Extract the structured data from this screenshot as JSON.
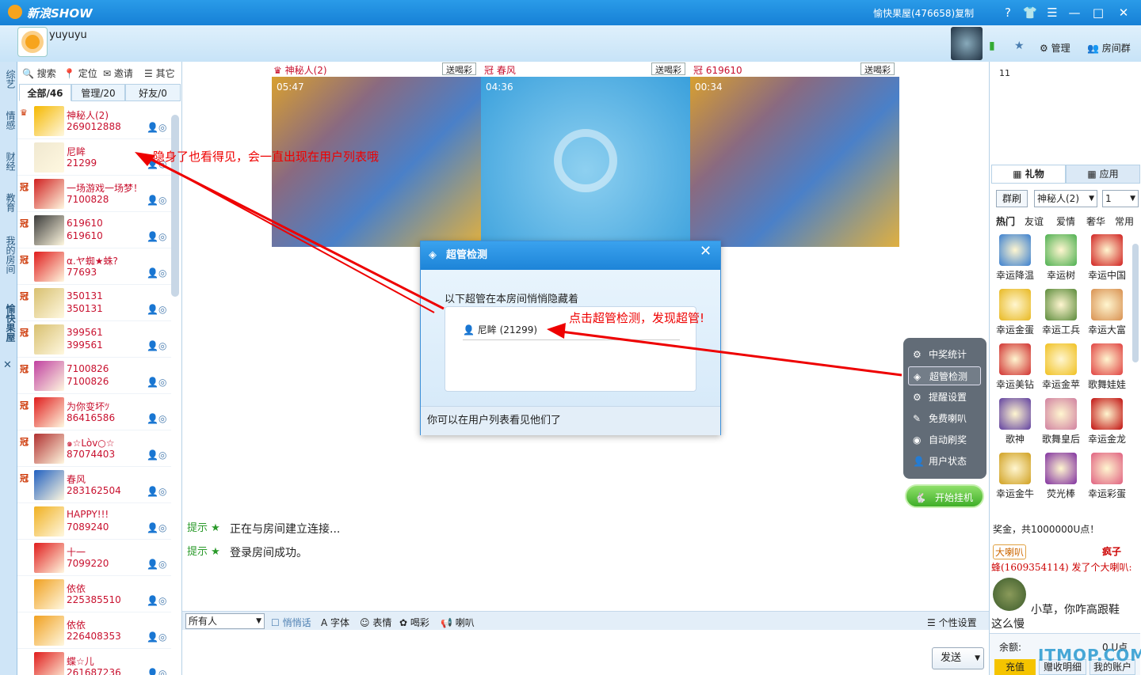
{
  "app": {
    "logo": "新浪SHOW",
    "room_title": "愉快果屋(476658)复制",
    "user": "yuyuyu"
  },
  "topbar": {
    "manage": "管理",
    "room_group": "房间群"
  },
  "left_tabs": [
    "综艺",
    "情感",
    "财经",
    "教育",
    "我的房间",
    "愉快果屋"
  ],
  "userpanel": {
    "tools": [
      "搜索",
      "定位",
      "邀请",
      "其它"
    ],
    "tabs": [
      "全部/46",
      "管理/20",
      "好友/0"
    ],
    "users": [
      {
        "name": "神秘人(2)",
        "id": "269012888",
        "badge": "♛",
        "color": "#f5b800"
      },
      {
        "name": "尼眸",
        "id": "21299",
        "badge": "",
        "color": "#f0e8d0"
      },
      {
        "name": "一场游戏一场梦！",
        "id": "7100828",
        "badge": "冠",
        "color": "#d02020"
      },
      {
        "name": "619610",
        "id": "619610",
        "badge": "冠",
        "color": "#3a3a3a"
      },
      {
        "name": "α.ヤ蜘★蛛?",
        "id": "77693",
        "badge": "冠",
        "color": "#e01c1c"
      },
      {
        "name": "350131",
        "id": "350131",
        "badge": "冠",
        "color": "#d8c070"
      },
      {
        "name": "399561",
        "id": "399561",
        "badge": "冠",
        "color": "#d8c070"
      },
      {
        "name": "7100826",
        "id": "7100826",
        "badge": "冠",
        "color": "#c040a0"
      },
      {
        "name": "为你变坏ﾂ",
        "id": "86416586",
        "badge": "冠",
        "color": "#e01c1c"
      },
      {
        "name": "๑☆Lòv○☆",
        "id": "87074403",
        "badge": "冠",
        "color": "#b03030"
      },
      {
        "name": "春风",
        "id": "283162504",
        "badge": "冠",
        "color": "#2060c0"
      },
      {
        "name": "HAPPY!!!",
        "id": "7089240",
        "badge": "",
        "color": "#f0b020"
      },
      {
        "name": "十一",
        "id": "7099220",
        "badge": "",
        "color": "#e01c1c"
      },
      {
        "name": "依依",
        "id": "225385510",
        "badge": "",
        "color": "#f0a020"
      },
      {
        "name": "依依",
        "id": "226408353",
        "badge": "",
        "color": "#f0a020"
      },
      {
        "name": "蝶☆儿",
        "id": "261687236",
        "badge": "",
        "color": "#e01c1c"
      }
    ]
  },
  "video": {
    "slots": [
      {
        "name": "神秘人(2)",
        "time": "05:47",
        "btn": "送喝彩"
      },
      {
        "name": "春风",
        "time": "04:36",
        "btn": "送喝彩"
      },
      {
        "name": "619610",
        "time": "00:34",
        "btn": "送喝彩"
      }
    ]
  },
  "chat": {
    "messages": [
      {
        "tag": "提示",
        "text": "正在与房间建立连接..."
      },
      {
        "tag": "提示",
        "text": "登录房间成功。"
      }
    ]
  },
  "toolbar": {
    "target": "所有人",
    "whisper": "悄悄话",
    "font": "字体",
    "emoji": "表情",
    "cheer": "喝彩",
    "horn": "喇叭",
    "settings": "个性设置",
    "send": "发送"
  },
  "dialog": {
    "title": "超管检测",
    "desc": "以下超管在本房间悄悄隐藏着",
    "entry": "尼眸 (21299)",
    "footer": "你可以在用户列表看见他们了"
  },
  "menu": {
    "items": [
      "中奖统计",
      "超管检测",
      "提醒设置",
      "免费喇叭",
      "自动刷奖",
      "用户状态"
    ],
    "guaji": "开始挂机"
  },
  "rightpanel": {
    "top_num": "11",
    "tabs": [
      "礼物",
      "应用"
    ],
    "row2": {
      "btn": "群刷",
      "target": "神秘人(2)",
      "qty": "1"
    },
    "cats": [
      "热门",
      "友谊",
      "爱情",
      "奢华",
      "常用"
    ],
    "gifts": [
      {
        "n": "幸运降温",
        "c": "#3a7fd0"
      },
      {
        "n": "幸运树",
        "c": "#4caf50"
      },
      {
        "n": "幸运中国",
        "c": "#d02020"
      },
      {
        "n": "幸运金蛋",
        "c": "#e8b820"
      },
      {
        "n": "幸运工兵",
        "c": "#5a8a3a"
      },
      {
        "n": "幸运大富",
        "c": "#d89050"
      },
      {
        "n": "幸运美钻",
        "c": "#d03030"
      },
      {
        "n": "幸运金苹",
        "c": "#f0c020"
      },
      {
        "n": "歌舞娃娃",
        "c": "#e04040"
      },
      {
        "n": "歌神",
        "c": "#6040a0"
      },
      {
        "n": "歌舞皇后",
        "c": "#d080a0"
      },
      {
        "n": "幸运金龙",
        "c": "#c01010"
      },
      {
        "n": "幸运金牛",
        "c": "#d0a020"
      },
      {
        "n": "荧光棒",
        "c": "#8030a0"
      },
      {
        "n": "幸运彩蛋",
        "c": "#e06080"
      }
    ],
    "msg1": "奖金，共1000000U点！",
    "msg2_a": "大喇叭",
    "msg2_b": "疯子",
    "msg3": "蜂(1609354114) 发了个大喇叭:",
    "msg4": "小草，你咋高跟鞋",
    "msg5": "这么慢",
    "balance_label": "余额:",
    "balance_val": "0 U点",
    "btns": [
      "充值",
      "赠收明细",
      "我的账户"
    ]
  },
  "annotations": {
    "a1": "隐身了也看得见，会一直出现在用户列表哦",
    "a2": "点击超管检测，发现超管!"
  },
  "watermark": "ITMOP.COM"
}
